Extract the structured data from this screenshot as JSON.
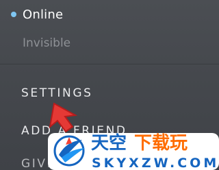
{
  "status": {
    "online_label": "Online",
    "invisible_label": "Invisible",
    "online_color": "#7fc6f2"
  },
  "menu": {
    "items": [
      {
        "label": "SETTINGS"
      },
      {
        "label": "ADD A FRIEND"
      },
      {
        "label": "GIVE"
      }
    ]
  },
  "watermark": {
    "title": "天空下载玩",
    "subtitle": "SKYXZW.COM"
  },
  "cursor": {
    "icon": "red-arrow-cursor-icon",
    "color": "#e53935"
  }
}
